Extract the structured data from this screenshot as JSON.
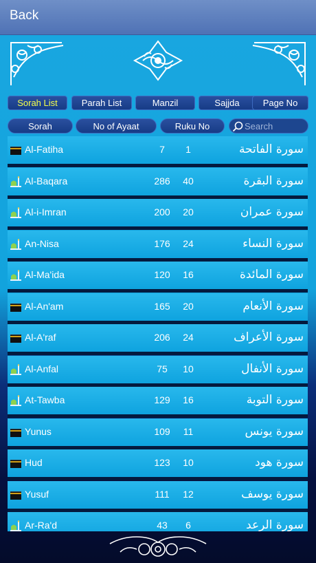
{
  "nav": {
    "back_label": "Back"
  },
  "tabs": [
    {
      "label": "Sorah List",
      "active": true
    },
    {
      "label": "Parah List",
      "active": false
    },
    {
      "label": "Manzil",
      "active": false
    },
    {
      "label": "Sajjda",
      "active": false
    },
    {
      "label": "Page No",
      "active": false
    }
  ],
  "sort": {
    "sorah_label": "Sorah",
    "ayaat_label": "No of Ayaat",
    "ruku_label": "Ruku No",
    "search_placeholder": "Search"
  },
  "colors": {
    "active_tab_text": "#f6ff4a",
    "row_bg": "#14a8e4",
    "nav_bg": "#5b7dbd"
  },
  "surahs": [
    {
      "name": "Al-Fatiha",
      "ayaat": "7",
      "ruku": "1",
      "arabic": "سورة الفاتحة",
      "icon": "kaaba-icon"
    },
    {
      "name": "Al-Baqara",
      "ayaat": "286",
      "ruku": "40",
      "arabic": "سورة البقرة",
      "icon": "mosque-icon"
    },
    {
      "name": "Al-i-Imran",
      "ayaat": "200",
      "ruku": "20",
      "arabic": "سورة عمران",
      "icon": "mosque-icon"
    },
    {
      "name": "An-Nisa",
      "ayaat": "176",
      "ruku": "24",
      "arabic": "سورة النساء",
      "icon": "mosque-icon"
    },
    {
      "name": "Al-Ma'ida",
      "ayaat": "120",
      "ruku": "16",
      "arabic": "سورة المائدة",
      "icon": "mosque-icon"
    },
    {
      "name": "Al-An'am",
      "ayaat": "165",
      "ruku": "20",
      "arabic": "سورة الأنعام",
      "icon": "kaaba-icon"
    },
    {
      "name": "Al-A'raf",
      "ayaat": "206",
      "ruku": "24",
      "arabic": "سورة الأعراف",
      "icon": "kaaba-icon"
    },
    {
      "name": "Al-Anfal",
      "ayaat": "75",
      "ruku": "10",
      "arabic": "سورة الأنفال",
      "icon": "mosque-icon"
    },
    {
      "name": "At-Tawba",
      "ayaat": "129",
      "ruku": "16",
      "arabic": "سورة التوبة",
      "icon": "mosque-icon"
    },
    {
      "name": "Yunus",
      "ayaat": "109",
      "ruku": "11",
      "arabic": "سورة يونس",
      "icon": "kaaba-icon"
    },
    {
      "name": "Hud",
      "ayaat": "123",
      "ruku": "10",
      "arabic": "سورة هود",
      "icon": "kaaba-icon"
    },
    {
      "name": "Yusuf",
      "ayaat": "111",
      "ruku": "12",
      "arabic": "سورة يوسف",
      "icon": "kaaba-icon"
    },
    {
      "name": "Ar-Ra'd",
      "ayaat": "43",
      "ruku": "6",
      "arabic": "سورة الرعد",
      "icon": "mosque-icon"
    }
  ]
}
